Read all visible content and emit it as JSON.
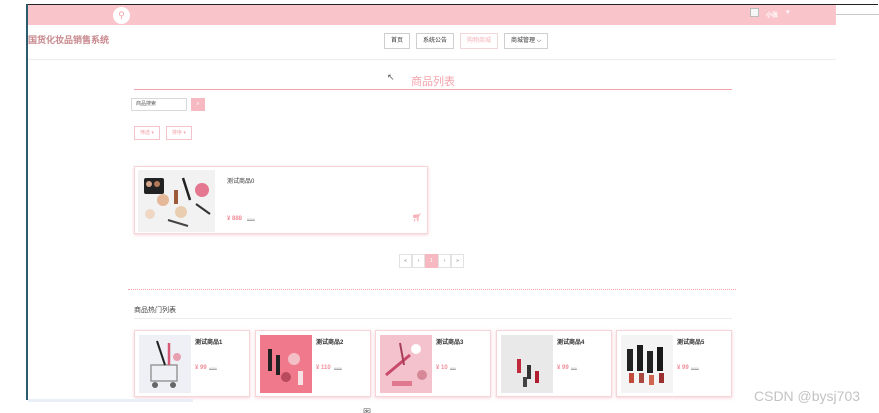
{
  "header": {
    "brand": "国货化妆品销售系统",
    "user_name": "小张",
    "user_caret": "▾",
    "search_icon": "⚲",
    "avatar_icon": "broken-image-icon"
  },
  "nav": {
    "items": [
      "首页",
      "系统公告",
      "购物商城",
      "商城管理 ⌵"
    ],
    "active_index": 2
  },
  "colors": {
    "accent": "#f3a3ac",
    "topbar": "#f9c5cb",
    "price": "#f08e98"
  },
  "products": {
    "title": "商品列表",
    "search_placeholder": "商品搜索",
    "search_btn_icon": "⌕",
    "filters": [
      "筛选 ▾",
      "排序 ▾"
    ],
    "items": [
      {
        "name": "测试商品0",
        "price": "¥ 888",
        "old_price": "¥999"
      }
    ],
    "cart_icon": "🛒︎"
  },
  "pagination": {
    "buttons": [
      "«",
      "‹",
      "1",
      "›",
      "»"
    ],
    "current": "1"
  },
  "hot": {
    "title": "商品热门列表",
    "items": [
      {
        "name": "测试商品1",
        "price": "¥ 99",
        "old": "¥999"
      },
      {
        "name": "测试商品2",
        "price": "¥ 110",
        "old": "¥999"
      },
      {
        "name": "测试商品3",
        "price": "¥ 10",
        "old": "¥99"
      },
      {
        "name": "测试商品4",
        "price": "¥ 99",
        "old": "¥99"
      },
      {
        "name": "测试商品5",
        "price": "¥ 99",
        "old": "¥999"
      }
    ]
  },
  "footer": {
    "caption": "图",
    "watermark": "CSDN @bysj703"
  }
}
